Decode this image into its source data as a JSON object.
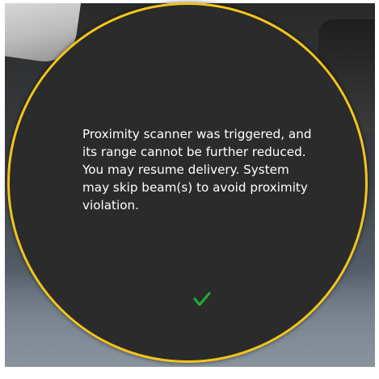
{
  "dialog": {
    "message": "Proximity scanner was triggered, and\nits range cannot be further reduced.\nYou may resume delivery.  System\nmay skip beam(s) to avoid proximity\nviolation.",
    "confirm_icon": "checkmark-icon"
  },
  "colors": {
    "dialog_border": "#f3c51b",
    "dialog_background": "#2b2b2b",
    "message_text": "#ffffff",
    "confirm_check": "#23a83a"
  }
}
